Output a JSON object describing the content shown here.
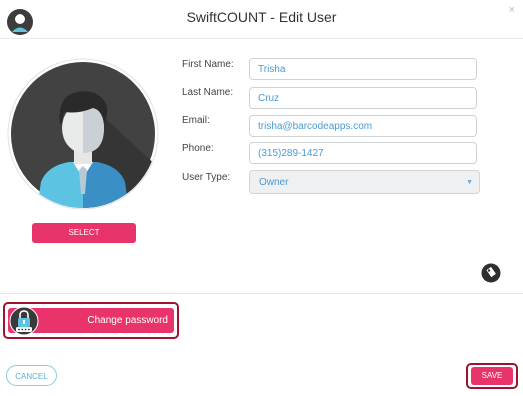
{
  "window": {
    "title": "SwiftCOUNT - Edit User",
    "close_label": "×"
  },
  "icons": {
    "logo": "user-avatar-logo-icon",
    "tag": "tag-icon",
    "lock": "lock-icon",
    "select_arrow": "▼"
  },
  "avatar": {
    "select_label": "SELECT"
  },
  "form": {
    "first_name": {
      "label": "First Name:",
      "value": "Trisha"
    },
    "last_name": {
      "label": "Last Name:",
      "value": "Cruz"
    },
    "email": {
      "label": "Email:",
      "value": "trisha@barcodeapps.com"
    },
    "phone": {
      "label": "Phone:",
      "value": "(315)289-1427"
    },
    "user_type": {
      "label": "User Type:",
      "value": "Owner"
    }
  },
  "actions": {
    "change_password_label": "Change password",
    "cancel_label": "CANCEL",
    "save_label": "SAVE"
  },
  "colors": {
    "accent": "#e8346b",
    "highlight_border": "#a0132c",
    "input_text": "#4a9ad4"
  }
}
